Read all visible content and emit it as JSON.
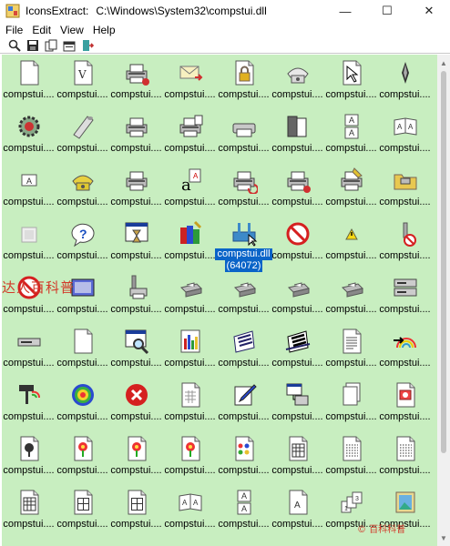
{
  "window": {
    "app_name": "IconsExtract:",
    "file_path": "C:\\Windows\\System32\\compstui.dll",
    "minimize": "—",
    "maximize": "☐",
    "close": "✕"
  },
  "menu": [
    "File",
    "Edit",
    "View",
    "Help"
  ],
  "toolbar": [
    "search-icon",
    "save-icon",
    "copy-icon",
    "properties-icon",
    "exit-icon"
  ],
  "icon_label": "compstui....",
  "selected": {
    "label": "compstui.dll",
    "id": "(64072)"
  },
  "watermark": "达人百科普",
  "watermark_bottom": "© 百科科普",
  "icons": [
    "blank-page-icon",
    "v-document-icon",
    "printer-network-icon",
    "envelope-icon",
    "padlock-icon",
    "telephone-icon",
    "document-pointer-icon",
    "pen-icon",
    "gear-shield-icon",
    "paper-roll-icon",
    "printer-icon",
    "printer-paper-icon",
    "printer-flat-icon",
    "duplex-icon",
    "letter-a-stack-icon",
    "book-aa-icon",
    "a-paper-icon",
    "telephone-yellow-icon",
    "printer-icon",
    "font-a-icon",
    "printer-refresh-icon",
    "printer-network-icon",
    "printer-paint-icon",
    "folder-printer-icon",
    "paper-gray-icon",
    "help-question-icon",
    "window-hourglass-icon",
    "paint-tools-icon",
    "printer-tray-selected-icon",
    "no-sign-icon",
    "warning-small-icon",
    "tool-no-icon",
    "no-sign-icon",
    "screen-panel-icon",
    "tool-printer-icon",
    "printer-gray-icon",
    "printer-gray-icon",
    "printer-gray-icon",
    "printer-gray-icon",
    "printer-server-icon",
    "drive-icon",
    "blank-page-icon",
    "magnifier-window-icon",
    "chart-bars-icon",
    "paper-fan-icon",
    "paper-fan-dark-icon",
    "document-text-icon",
    "rainbow-arrow-icon",
    "paint-roller-icon",
    "target-icon",
    "error-x-icon",
    "document-grid-icon",
    "pen-page-icon",
    "network-window-icon",
    "pages-stack-icon",
    "photo-page-icon",
    "tree-print-icon",
    "flower-print-icon",
    "flower-print-icon",
    "flower-print-icon",
    "color-palette-icon",
    "grid-page-icon",
    "dots-page-icon",
    "dots-page-icon",
    "grid-page-icon",
    "window-page-icon",
    "window-page-icon",
    "book-aa-icon",
    "letter-a-stack-icon",
    "letter-a-page-icon",
    "numbered-stack-icon",
    "picture-frame-icon"
  ]
}
